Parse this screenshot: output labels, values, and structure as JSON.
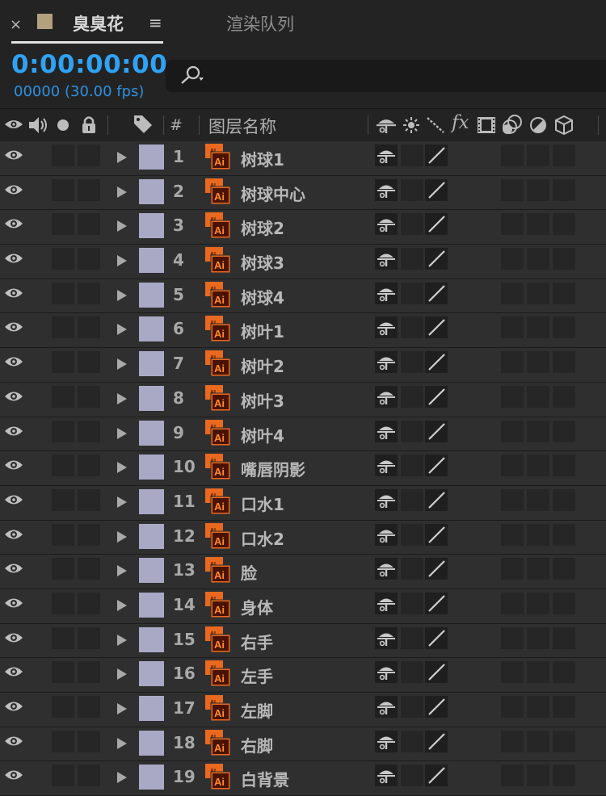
{
  "tab": {
    "close": "×",
    "swatch_color": "#b2a07e",
    "title": "臭臭花",
    "menu": "≡",
    "second": "渲染队列"
  },
  "timecode": "0:00:00:00",
  "fps": "00000 (30.00 fps)",
  "search": {
    "value": "",
    "icon": "search-icon"
  },
  "header": {
    "col_number": "#",
    "col_layer_name": "图层名称",
    "col_fx": "fx",
    "icons": [
      "eye-icon",
      "speaker-icon",
      "solo-dot-icon",
      "lock-icon",
      "label-tag-icon",
      "shy-icon",
      "collapse-sun-icon",
      "quality-slash-icon",
      "fx-icon",
      "motion-blur-film-icon",
      "adjustment-icon",
      "blend-circle-icon",
      "3d-cube-icon"
    ]
  },
  "colors": {
    "timecode": "#2fa2f4",
    "label_lavender": "#a9a9c6",
    "ai_orange": "#e8691f"
  },
  "ai_badge": {
    "top": "AI",
    "bottom": "Ai"
  },
  "layers": [
    {
      "num": "1",
      "name": "树球1"
    },
    {
      "num": "2",
      "name": "树球中心"
    },
    {
      "num": "3",
      "name": "树球2"
    },
    {
      "num": "4",
      "name": "树球3"
    },
    {
      "num": "5",
      "name": "树球4"
    },
    {
      "num": "6",
      "name": "树叶1"
    },
    {
      "num": "7",
      "name": "树叶2"
    },
    {
      "num": "8",
      "name": "树叶3"
    },
    {
      "num": "9",
      "name": "树叶4"
    },
    {
      "num": "10",
      "name": "嘴唇阴影"
    },
    {
      "num": "11",
      "name": "口水1"
    },
    {
      "num": "12",
      "name": "口水2"
    },
    {
      "num": "13",
      "name": "脸"
    },
    {
      "num": "14",
      "name": "身体"
    },
    {
      "num": "15",
      "name": "右手"
    },
    {
      "num": "16",
      "name": "左手"
    },
    {
      "num": "17",
      "name": "左脚"
    },
    {
      "num": "18",
      "name": "右脚"
    },
    {
      "num": "19",
      "name": "白背景"
    }
  ]
}
